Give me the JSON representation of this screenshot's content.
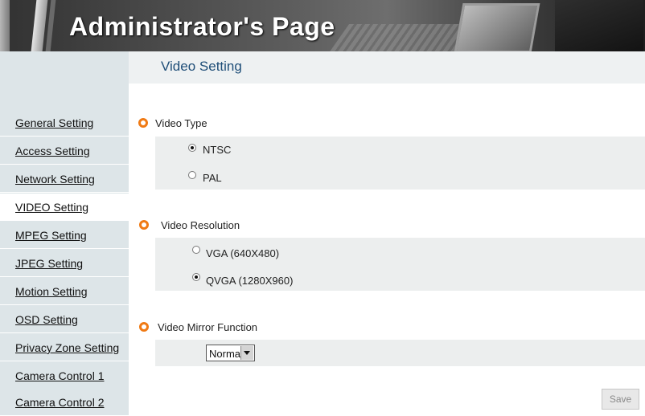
{
  "banner": {
    "title": "Administrator's Page"
  },
  "page": {
    "title": "Video Setting"
  },
  "sidebar": {
    "items": [
      {
        "label": "General Setting"
      },
      {
        "label": "Access Setting"
      },
      {
        "label": "Network Setting"
      },
      {
        "label": "VIDEO Setting"
      },
      {
        "label": "MPEG Setting"
      },
      {
        "label": "JPEG Setting"
      },
      {
        "label": "Motion Setting"
      },
      {
        "label": "OSD Setting"
      },
      {
        "label": "Privacy Zone Setting"
      },
      {
        "label": "Camera Control 1"
      },
      {
        "label": "Camera Control 2"
      }
    ],
    "active_index": 3
  },
  "video_type": {
    "label": "Video Type",
    "options": [
      {
        "label": "NTSC",
        "selected": true
      },
      {
        "label": "PAL",
        "selected": false
      }
    ]
  },
  "video_resolution": {
    "label": "Video Resolution",
    "options": [
      {
        "label": "VGA (640X480)",
        "selected": false
      },
      {
        "label": "QVGA (1280X960)",
        "selected": true
      }
    ]
  },
  "video_mirror": {
    "label": "Video Mirror Function",
    "value": "Normal"
  },
  "actions": {
    "save_label": "Save"
  },
  "colors": {
    "sidebar_bg": "#dde5e8",
    "title_color": "#1f4e78",
    "bullet_color": "#f07a14",
    "panel_bg": "#eceeee"
  }
}
